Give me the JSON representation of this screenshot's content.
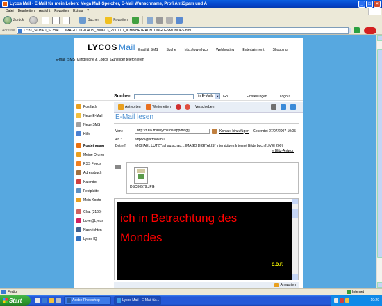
{
  "window": {
    "title": "Lycos Mail - E-Mail für mein Leben: Mega Mail-Speicher, E-Mail Wunschname, Profi AntiSpam und A"
  },
  "menubar": [
    "Datei",
    "Bearbeiten",
    "Ansicht",
    "Favoriten",
    "Extras",
    "?"
  ],
  "toolbar": {
    "back": "Zurück",
    "search": "Suchen",
    "favorites": "Favoriten"
  },
  "address": {
    "label": "Adresse",
    "url": "C:\\31_SCHAU_SCHAU.....IMAGO DIGITALIS_2006\\13_27.07.07_ICHINBETRACHTUNGDESMONDES.htm",
    "go_label": ""
  },
  "lycos": {
    "logo": "LYCOS",
    "logo_mail": "Mail",
    "topnav": [
      "Email & SMS",
      "Suche",
      "http://www.lyco",
      "Webhosting",
      "Entertainment",
      "Shopping"
    ],
    "subnav": [
      "E-mail",
      "SMS",
      "Klingeltöne & Logos",
      "Günstiger telefonieren"
    ]
  },
  "search": {
    "label": "Suchen",
    "scope": "in E-Mails",
    "go": "Go",
    "settings": "Einstellungen",
    "logout": "Logout"
  },
  "leftnav": [
    {
      "label": "Postfach",
      "color": "#e8a020",
      "bold": false
    },
    {
      "label": "Neue E-Mail",
      "color": "#f0c040",
      "bold": false
    },
    {
      "label": "Neue SMS",
      "color": "#a0a0a0",
      "bold": false
    },
    {
      "label": "Hilfe",
      "color": "#4a80d0",
      "bold": false
    },
    {
      "label": "Posteingang",
      "color": "#e87010",
      "bold": true
    },
    {
      "label": "Meine Ordner",
      "color": "#e8a020",
      "bold": false
    },
    {
      "label": "RSS Feeds",
      "color": "#f08020",
      "bold": false
    },
    {
      "label": "Adressbuch",
      "color": "#a07040",
      "bold": false
    },
    {
      "label": "Kalender",
      "color": "#d04040",
      "bold": false
    },
    {
      "label": "Festplatte",
      "color": "#6090c0",
      "bold": false
    },
    {
      "label": "Mein Konto",
      "color": "#e8a020",
      "bold": false
    },
    {
      "label": "Chat (3166)",
      "color": "#d06060",
      "bold": false
    },
    {
      "label": "Love@Lycos",
      "color": "#d02060",
      "bold": false
    },
    {
      "label": "Nachrichten",
      "color": "#406090",
      "bold": false
    },
    {
      "label": "Lycos IQ",
      "color": "#3070c0",
      "bold": false
    }
  ],
  "actions": {
    "reply": "Antworten",
    "forward": "Weiterleiten",
    "move": "Verschieben"
  },
  "email": {
    "headline": "E-Mail lesen",
    "from_label": "Von :",
    "from": "http://f006.mail.lycos.de/app/msg/j",
    "add_contact": "Kontakt hinzufügen",
    "date": "Gesendet 27/07/2007 10:05",
    "to_label": "An :",
    "to": "artpool@artpool.hu",
    "subject_label": "Betreff",
    "subject": "MICHAEL LUTZ \"schau.schau....IMAGO DIGITALIS\" Interaktives Internet Bilderbuch [LIVE] 2007",
    "blitz": "» Blitz-Antwort",
    "attachment": "DSC00579.JPG",
    "body_line1": "ich in Betrachtung des",
    "body_line2": "Mondes",
    "signature": "C.D.F.",
    "bottom_reply": "Antworten"
  },
  "status": {
    "text": "Fertig",
    "zone": "Internet"
  },
  "taskbar": {
    "start": "Start",
    "tasks": [
      "Adobe Photoshop",
      "Lycos Mail - E-Mail für..."
    ],
    "clock": "10:29"
  }
}
